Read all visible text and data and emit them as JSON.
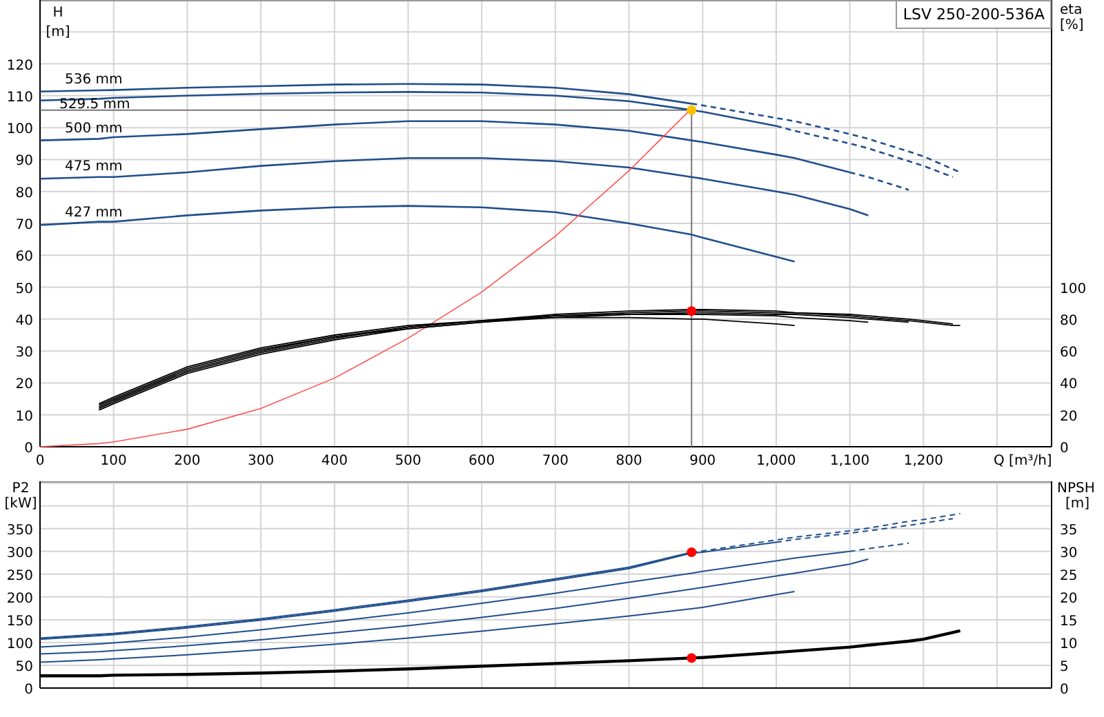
{
  "charts": [
    {
      "legend": "LSV 250-200-536A",
      "left_unit": "[m]",
      "right_unit": "[%]",
      "chart_data": {
        "type": "line",
        "grid": true,
        "xlabel": "Q [m³/h]",
        "ylabel": "H",
        "y2label": "eta",
        "xlim": [
          0,
          1374
        ],
        "ylim": [
          0,
          140
        ],
        "y2lim": [
          0,
          280
        ],
        "xticks": [
          {
            "value": 0,
            "label": "0"
          },
          {
            "value": 100,
            "label": "100"
          },
          {
            "value": 200,
            "label": "200"
          },
          {
            "value": 300,
            "label": "300"
          },
          {
            "value": 400,
            "label": "400"
          },
          {
            "value": 500,
            "label": "500"
          },
          {
            "value": 600,
            "label": "600"
          },
          {
            "value": 700,
            "label": "700"
          },
          {
            "value": 800,
            "label": "800"
          },
          {
            "value": 900,
            "label": "900"
          },
          {
            "value": 1000,
            "label": "1,000"
          },
          {
            "value": 1100,
            "label": "1,100"
          },
          {
            "value": 1200,
            "label": "1,200"
          }
        ],
        "yticks": [
          0,
          10,
          20,
          30,
          40,
          50,
          60,
          70,
          80,
          90,
          100,
          110,
          120
        ],
        "y2ticks": [
          0,
          20,
          40,
          60,
          80,
          100
        ],
        "x": [
          0,
          80,
          100,
          200,
          300,
          400,
          500,
          600,
          700,
          800,
          885,
          900,
          1000,
          1025,
          1100,
          1125,
          1180,
          1200,
          1240,
          1250
        ],
        "series": [
          {
            "name": "536 mm",
            "color": "#1f4e8c",
            "values": [
              111.3,
              111.7,
              111.8,
              112.5,
              113,
              113.5,
              113.7,
              113.5,
              112.5,
              110.5,
              107.5,
              null,
              null,
              null,
              null,
              null,
              null,
              null,
              null,
              null
            ]
          },
          {
            "color": "#1f4e8c",
            "line_style": "dashed",
            "values": [
              null,
              null,
              null,
              null,
              null,
              null,
              null,
              null,
              null,
              null,
              107.5,
              107,
              103,
              102,
              98,
              96.5,
              92.5,
              91,
              87,
              86
            ]
          },
          {
            "name": "529.5 mm",
            "color": "#1f4e8c",
            "values": [
              108.5,
              109,
              109.3,
              110,
              110.6,
              111,
              111.2,
              111,
              110,
              108.3,
              105.5,
              105,
              100.5,
              null,
              null,
              null,
              null,
              null,
              null,
              null
            ]
          },
          {
            "color": "#1f4e8c",
            "line_style": "dashed",
            "values": [
              null,
              null,
              null,
              null,
              null,
              null,
              null,
              null,
              null,
              null,
              null,
              null,
              100.5,
              99,
              95,
              93.5,
              89.5,
              88,
              84.5,
              null
            ]
          },
          {
            "name": "500 mm",
            "color": "#1f4e8c",
            "values": [
              96,
              96.5,
              97,
              98,
              99.5,
              101,
              102,
              102,
              101,
              99,
              96,
              95.5,
              91.5,
              90.5,
              86,
              null,
              null,
              null,
              null,
              null
            ]
          },
          {
            "color": "#1f4e8c",
            "line_style": "dashed",
            "values": [
              null,
              null,
              null,
              null,
              null,
              null,
              null,
              null,
              null,
              null,
              null,
              null,
              null,
              null,
              86,
              84.5,
              80.5,
              null,
              null,
              null
            ]
          },
          {
            "name": "475 mm",
            "color": "#1f4e8c",
            "values": [
              84,
              84.5,
              84.5,
              86,
              88,
              89.5,
              90.5,
              90.5,
              89.5,
              87.5,
              84.5,
              84,
              80,
              79,
              74.5,
              72.5,
              null,
              null,
              null,
              null
            ]
          },
          {
            "name": "427 mm",
            "color": "#1f4e8c",
            "values": [
              69.5,
              70.5,
              70.5,
              72.5,
              74,
              75,
              75.5,
              75,
              73.5,
              70,
              66.5,
              65.5,
              59.5,
              58,
              null,
              null,
              null,
              null,
              null,
              null
            ]
          },
          {
            "color": "#ff5050",
            "values": [
              0,
              1,
              1.5,
              5.5,
              12,
              21.5,
              34,
              48.5,
              66,
              86.5,
              106,
              null,
              null,
              null,
              null,
              null,
              null,
              null,
              null,
              null
            ]
          },
          {
            "axis": "y2",
            "color": "#000000",
            "values": [
              null,
              23,
              27,
              46,
              58,
              67,
              74,
              78,
              82,
              84,
              85,
              85,
              84,
              84,
              82,
              81,
              79,
              78,
              76,
              76
            ]
          },
          {
            "axis": "y2",
            "color": "#000000",
            "values": [
              null,
              24,
              28,
              47,
              59,
              68,
              75,
              79,
              83,
              85,
              86,
              86,
              85,
              84,
              83,
              82,
              80,
              79,
              77,
              null
            ]
          },
          {
            "axis": "y2",
            "color": "#000000",
            "values": [
              null,
              25,
              29,
              48,
              60,
              69,
              74,
              78,
              81,
              83,
              84,
              84,
              83,
              83,
              81,
              80,
              78,
              null,
              null,
              null
            ]
          },
          {
            "axis": "y2",
            "color": "#000000",
            "values": [
              null,
              26,
              30,
              49,
              61,
              69,
              75,
              79,
              82,
              83,
              83,
              83,
              82,
              81,
              79,
              78,
              null,
              null,
              null,
              null
            ]
          },
          {
            "axis": "y2",
            "color": "#000000",
            "values": [
              null,
              27,
              31,
              50,
              62,
              70,
              76,
              79,
              81,
              81,
              80,
              80,
              77,
              76,
              null,
              null,
              null,
              null,
              null,
              null
            ]
          },
          {
            "color": "#ffc000",
            "marker": "circle",
            "values": [
              null,
              null,
              null,
              null,
              null,
              null,
              null,
              null,
              null,
              null,
              105.5,
              null,
              null,
              null,
              null,
              null,
              null,
              null,
              null,
              null
            ]
          },
          {
            "axis": "y2",
            "color": "#ff0000",
            "marker": "circle",
            "values": [
              null,
              null,
              null,
              null,
              null,
              null,
              null,
              null,
              null,
              null,
              85,
              null,
              null,
              null,
              null,
              null,
              null,
              null,
              null,
              null
            ]
          }
        ],
        "ref_lines": [
          {
            "axis": "x",
            "value": 885
          },
          {
            "axis": "y",
            "value": 105.5
          }
        ]
      }
    },
    {
      "left_unit": "[kW]",
      "right_unit": "[m]",
      "chart_data": {
        "type": "line",
        "grid": true,
        "ylabel": "P2",
        "y2label": "NPSH",
        "xlim": [
          0,
          1374
        ],
        "ylim": [
          0,
          454
        ],
        "y2lim": [
          0,
          45.4
        ],
        "yticks": [
          0,
          50,
          100,
          150,
          200,
          250,
          300,
          350
        ],
        "y2ticks": [
          0,
          5,
          10,
          15,
          20,
          25,
          30,
          35
        ],
        "x": [
          0,
          80,
          100,
          200,
          300,
          400,
          500,
          600,
          700,
          800,
          885,
          900,
          1000,
          1025,
          1100,
          1125,
          1180,
          1200,
          1240,
          1250
        ],
        "series": [
          {
            "color": "#1f4e8c",
            "values": [
              110,
              118,
              120,
              135,
              152,
              172,
              193,
              215,
              240,
              265,
              298,
              null,
              null,
              null,
              null,
              null,
              null,
              null,
              null,
              null
            ]
          },
          {
            "color": "#1f4e8c",
            "line_style": "dashed",
            "values": [
              null,
              null,
              null,
              null,
              null,
              null,
              null,
              null,
              null,
              null,
              298,
              301,
              325,
              331,
              345,
              351,
              366,
              370,
              380,
              383
            ]
          },
          {
            "color": "#1f4e8c",
            "values": [
              107,
              115,
              117,
              132,
              149,
              169,
              190,
              212,
              237,
              262,
              296,
              298,
              320,
              null,
              null,
              null,
              null,
              null,
              null,
              null
            ]
          },
          {
            "color": "#1f4e8c",
            "line_style": "dashed",
            "values": [
              null,
              null,
              null,
              null,
              null,
              null,
              null,
              null,
              null,
              null,
              null,
              null,
              320,
              326,
              340,
              345,
              357,
              362,
              372,
              null
            ]
          },
          {
            "color": "#1f4e8c",
            "values": [
              90,
              97,
              99,
              112,
              128,
              146,
              165,
              186,
              208,
              232,
              252,
              256,
              279,
              285,
              300,
              null,
              null,
              null,
              null,
              null
            ]
          },
          {
            "color": "#1f4e8c",
            "line_style": "dashed",
            "values": [
              null,
              null,
              null,
              null,
              null,
              null,
              null,
              null,
              null,
              null,
              null,
              null,
              null,
              null,
              300,
              306,
              318,
              null,
              null,
              null
            ]
          },
          {
            "color": "#1f4e8c",
            "values": [
              75,
              80,
              82,
              93,
              106,
              121,
              137,
              155,
              175,
              197,
              217,
              221,
              246,
              252,
              272,
              283,
              null,
              null,
              null,
              null
            ]
          },
          {
            "color": "#1f4e8c",
            "values": [
              57,
              62,
              64,
              73,
              84,
              96,
              110,
              125,
              141,
              158,
              174,
              177,
              205,
              212,
              null,
              null,
              null,
              null,
              null,
              null
            ]
          },
          {
            "axis": "y2",
            "color": "#000000",
            "values": [
              2.7,
              2.7,
              2.8,
              3,
              3.3,
              3.7,
              4.2,
              4.8,
              5.4,
              6,
              6.6,
              6.7,
              7.8,
              8.1,
              9,
              9.4,
              10.3,
              10.7,
              12.2,
              12.6
            ]
          },
          {
            "color": "#ff0000",
            "marker": "circle",
            "values": [
              null,
              null,
              null,
              null,
              null,
              null,
              null,
              null,
              null,
              null,
              298,
              null,
              null,
              null,
              null,
              null,
              null,
              null,
              null,
              null
            ]
          },
          {
            "axis": "y2",
            "color": "#ff0000",
            "marker": "circle",
            "values": [
              null,
              null,
              null,
              null,
              null,
              null,
              null,
              null,
              null,
              null,
              6.6,
              null,
              null,
              null,
              null,
              null,
              null,
              null,
              null,
              null
            ]
          }
        ]
      }
    }
  ]
}
